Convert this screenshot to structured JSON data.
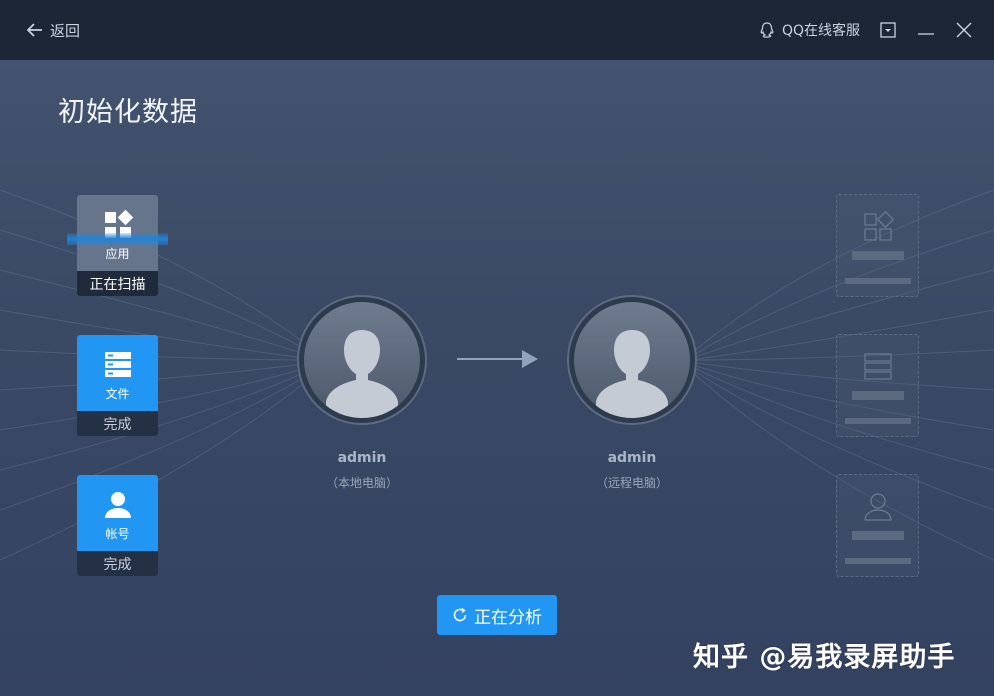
{
  "titlebar": {
    "back_label": "返回",
    "qq_service_label": "QQ在线客服"
  },
  "page": {
    "title": "初始化数据"
  },
  "categories": [
    {
      "label": "应用",
      "status": "正在扫描",
      "icon": "apps-grid-icon",
      "state": "scanning"
    },
    {
      "label": "文件",
      "status": "完成",
      "icon": "file-stack-icon",
      "state": "done"
    },
    {
      "label": "帐号",
      "status": "完成",
      "icon": "user-icon",
      "state": "done"
    }
  ],
  "local_user": {
    "name": "admin",
    "subtitle": "（本地电脑）"
  },
  "remote_user": {
    "name": "admin",
    "subtitle": "（远程电脑）"
  },
  "action": {
    "analyze_label": "正在分析"
  },
  "watermark": "知乎 @易我录屏助手",
  "colors": {
    "accent": "#2196f3",
    "titlebar_bg": "#1d2637",
    "main_bg": "#3a4a65"
  }
}
